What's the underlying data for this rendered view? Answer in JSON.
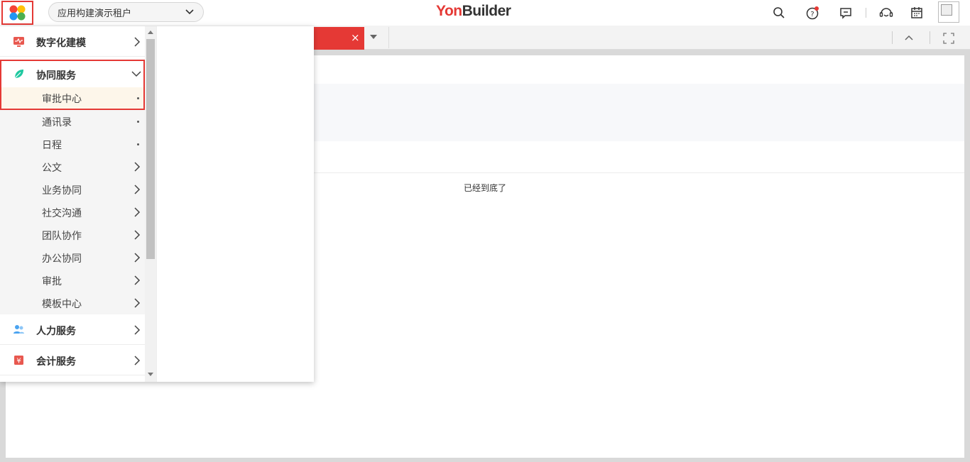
{
  "header": {
    "tenant_name": "应用构建演示租户",
    "logo_part1": "Yon",
    "logo_part2": "Builder",
    "icons": [
      "app-grid-icon",
      "search-icon",
      "help-icon",
      "message-icon",
      "service-icon",
      "calendar-icon"
    ],
    "notification_color": "#e53935"
  },
  "tabbar": {
    "close_glyph": "×"
  },
  "content": {
    "end_text": "已经到底了"
  },
  "menu": {
    "categories": [
      {
        "label": "数字化建模",
        "icon": "modeling-icon",
        "color": "#e8584f"
      },
      {
        "label": "协同服务",
        "icon": "leaf-icon",
        "color": "#1fc8a0",
        "expanded": true
      },
      {
        "label": "人力服务",
        "icon": "people-icon",
        "color": "#4aa3f0"
      },
      {
        "label": "会计服务",
        "icon": "yuan-icon",
        "color": "#e8584f"
      }
    ],
    "sub_items": [
      {
        "label": "审批中心",
        "type": "dot",
        "selected": true
      },
      {
        "label": "通讯录",
        "type": "dot"
      },
      {
        "label": "日程",
        "type": "dot"
      },
      {
        "label": "公文",
        "type": "arrow"
      },
      {
        "label": "业务协同",
        "type": "arrow"
      },
      {
        "label": "社交沟通",
        "type": "arrow"
      },
      {
        "label": "团队协作",
        "type": "arrow"
      },
      {
        "label": "办公协同",
        "type": "arrow"
      },
      {
        "label": "审批",
        "type": "arrow"
      },
      {
        "label": "模板中心",
        "type": "arrow"
      }
    ]
  },
  "colors": {
    "accent": "#e53935",
    "selected_bg": "#fdf6ea"
  }
}
